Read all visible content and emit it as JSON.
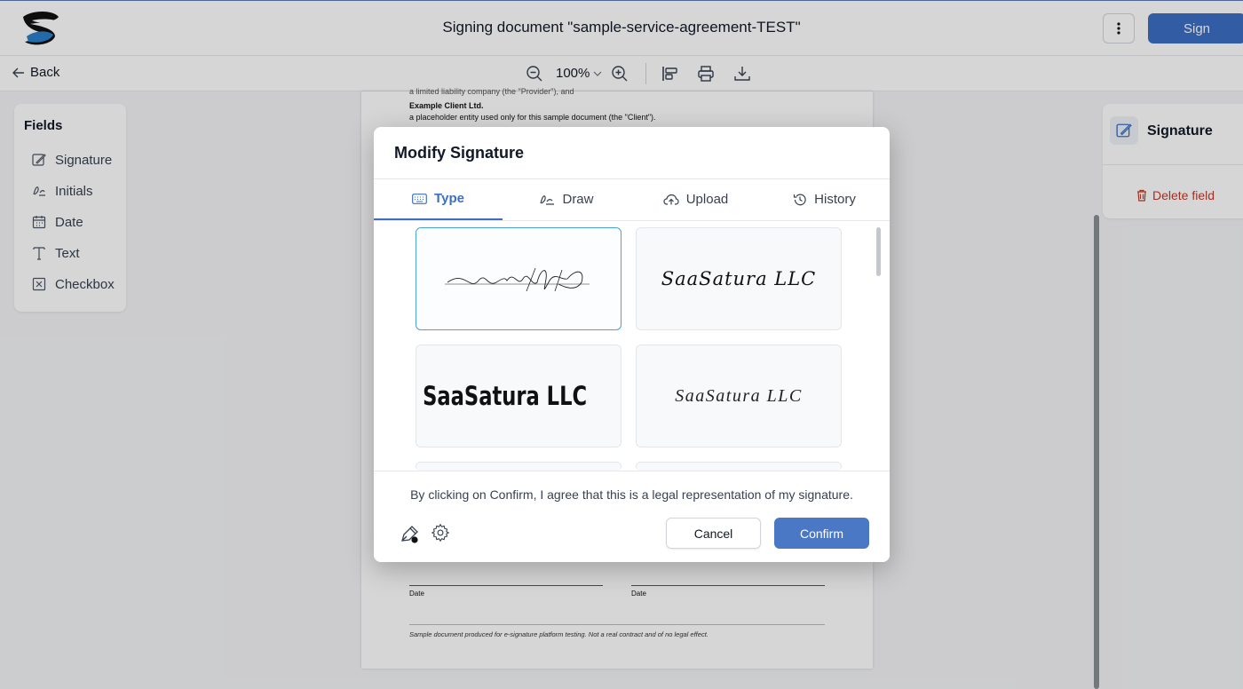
{
  "header": {
    "title": "Signing document \"sample-service-agreement-TEST\"",
    "sign_label": "Sign",
    "logo_icon": "brand-logo-icon",
    "menu_icon": "vertical-dots-icon"
  },
  "toolbar": {
    "back_label": "Back",
    "zoom": "100%",
    "icons": [
      "zoom-out-icon",
      "zoom-in-icon",
      "field-align-icon",
      "print-icon",
      "download-icon"
    ]
  },
  "fields_panel": {
    "title": "Fields",
    "items": [
      {
        "label": "Signature",
        "icon": "signature-icon"
      },
      {
        "label": "Initials",
        "icon": "initials-icon"
      },
      {
        "label": "Date",
        "icon": "calendar-icon"
      },
      {
        "label": "Text",
        "icon": "text-icon"
      },
      {
        "label": "Checkbox",
        "icon": "checkbox-icon"
      }
    ]
  },
  "document": {
    "line1": "a limited liability company (the \"Provider\"), and",
    "client_name": "Example Client Ltd.",
    "client_desc": "a placeholder entity used only for this sample document (the \"Client\").",
    "date_left": "Date",
    "date_right": "Date",
    "footer_note": "Sample document produced for e-signature platform testing. Not a real contract and of no legal effect."
  },
  "right_panel": {
    "title": "Signature",
    "delete_label": "Delete field"
  },
  "modal": {
    "title": "Modify Signature",
    "tabs": [
      {
        "label": "Type",
        "icon": "keyboard-icon",
        "active": true
      },
      {
        "label": "Draw",
        "icon": "draw-icon",
        "active": false
      },
      {
        "label": "Upload",
        "icon": "cloud-upload-icon",
        "active": false
      },
      {
        "label": "History",
        "icon": "history-icon",
        "active": false
      }
    ],
    "signature_options": [
      {
        "text": "SaaSatura LLC",
        "style": "thin-scribble",
        "selected": true
      },
      {
        "text": "SaaSatura LLC",
        "style": "italic-script",
        "selected": false
      },
      {
        "text": "SaaSatura LLC",
        "style": "bold-marker",
        "selected": false
      },
      {
        "text": "SaaSatura LLC",
        "style": "light-cursive",
        "selected": false
      }
    ],
    "legal_text": "By clicking on Confirm, I agree that this is a legal representation of my signature.",
    "cancel_label": "Cancel",
    "confirm_label": "Confirm",
    "footer_icons": [
      "pen-color-icon",
      "settings-gear-icon"
    ]
  },
  "colors": {
    "primary": "#3c6fc4",
    "danger": "#c0392b",
    "selected_border": "#4aa3d8"
  }
}
